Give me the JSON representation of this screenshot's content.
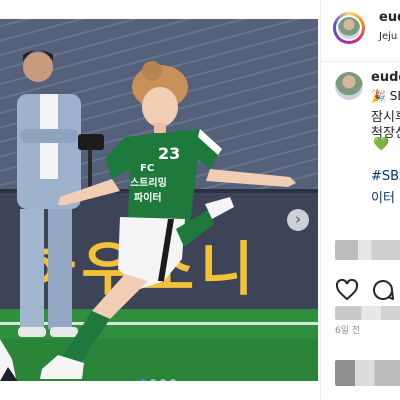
{
  "post": {
    "photo": {
      "alt": "Woman in green number 23 FC jersey kicking a football on a pitch",
      "jersey_number": "23",
      "jersey_text": [
        "FC",
        "스트리밍",
        "파이터"
      ],
      "banner_text": "하우소니",
      "next_arrow": "›",
      "carousel_index": 1,
      "carousel_count": 4
    }
  },
  "header": {
    "username": "eudd",
    "location": "Jeju ."
  },
  "caption": {
    "username": "eudd",
    "line1": "🎉 SB",
    "line2": "잠시후",
    "line3": "척장신",
    "heart": "💚",
    "hashtag": "#SBS",
    "line5": "이터"
  },
  "actions": {
    "like_icon": "heart-icon",
    "comment_icon": "comment-icon"
  },
  "meta": {
    "timestamp": "6일 전"
  },
  "colors": {
    "accent": "#2f8fff",
    "jersey_green": "#1e7a3c",
    "banner_yellow": "#f2c23a",
    "pitch_green": "#2f8f3e",
    "hashtag_blue": "#00376b"
  }
}
